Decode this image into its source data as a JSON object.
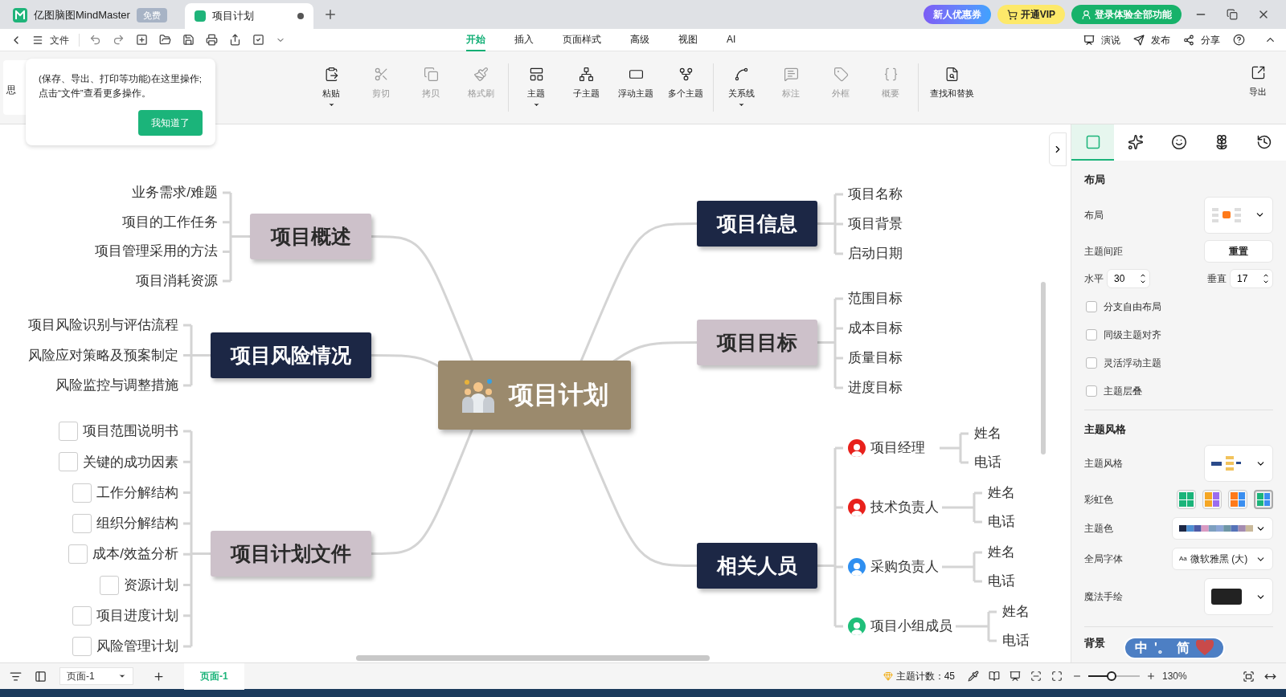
{
  "title_bar": {
    "app_tab": {
      "label": "亿图脑图MindMaster",
      "badge": "免费"
    },
    "doc_tab": {
      "label": "项目计划",
      "unsaved": true
    },
    "promos": [
      {
        "kind": "coupon",
        "label": "新人优惠券"
      },
      {
        "kind": "vip",
        "label": "开通VIP"
      },
      {
        "kind": "login",
        "label": "登录体验全部功能"
      }
    ]
  },
  "menu_bar": {
    "file": "文件",
    "tabs": [
      {
        "label": "开始",
        "selected": true
      },
      {
        "label": "插入",
        "selected": false
      },
      {
        "label": "页面样式",
        "selected": false
      },
      {
        "label": "高级",
        "selected": false
      },
      {
        "label": "视图",
        "selected": false
      },
      {
        "label": "AI",
        "selected": false
      }
    ],
    "actions": [
      {
        "kind": "present",
        "label": "演说"
      },
      {
        "kind": "publish",
        "label": "发布"
      },
      {
        "kind": "share",
        "label": "分享"
      }
    ]
  },
  "ribbon": {
    "hidden_item": "思",
    "groups": [
      [
        {
          "kind": "paste",
          "label": "粘贴",
          "disabled": false,
          "dropdown": true
        },
        {
          "kind": "cut",
          "label": "剪切",
          "disabled": true,
          "dropdown": false
        },
        {
          "kind": "copy",
          "label": "拷贝",
          "disabled": true,
          "dropdown": false
        },
        {
          "kind": "brush",
          "label": "格式刷",
          "disabled": true,
          "dropdown": false
        }
      ],
      [
        {
          "kind": "topic",
          "label": "主题",
          "disabled": false,
          "dropdown": true
        },
        {
          "kind": "subtopic",
          "label": "子主题",
          "disabled": false,
          "dropdown": false
        },
        {
          "kind": "float",
          "label": "浮动主题",
          "disabled": false,
          "dropdown": false
        },
        {
          "kind": "multi",
          "label": "多个主题",
          "disabled": false,
          "dropdown": false
        }
      ],
      [
        {
          "kind": "relation",
          "label": "关系线",
          "disabled": false,
          "dropdown": true
        },
        {
          "kind": "callout",
          "label": "标注",
          "disabled": true,
          "dropdown": false
        },
        {
          "kind": "boundary",
          "label": "外框",
          "disabled": true,
          "dropdown": false
        },
        {
          "kind": "summary",
          "label": "概要",
          "disabled": true,
          "dropdown": false
        }
      ],
      [
        {
          "kind": "find",
          "label": "查找和替换",
          "disabled": false,
          "dropdown": false
        }
      ]
    ],
    "export": "导出"
  },
  "tooltip": {
    "text": "(保存、导出、打印等功能)在这里操作;\n点击“文件”查看更多操作。",
    "button": "我知道了"
  },
  "mindmap": {
    "central": "项目计划",
    "branches": [
      {
        "label": "项目概述",
        "children": [
          {
            "kind": "text",
            "label": "业务需求/难题"
          },
          {
            "kind": "text",
            "label": "项目的工作任务"
          },
          {
            "kind": "text",
            "label": "项目管理采用的方法"
          },
          {
            "kind": "text",
            "label": "项目消耗资源"
          }
        ]
      },
      {
        "label": "项目风险情况",
        "children": [
          {
            "kind": "text",
            "label": "项目风险识别与评估流程"
          },
          {
            "kind": "text",
            "label": "风险应对策略及预案制定"
          },
          {
            "kind": "text",
            "label": "风险监控与调整措施"
          }
        ]
      },
      {
        "label": "项目计划文件",
        "children": [
          {
            "kind": "checkbox",
            "label": "项目范围说明书",
            "checked": false
          },
          {
            "kind": "checkbox",
            "label": "关键的成功因素",
            "checked": false
          },
          {
            "kind": "checkbox",
            "label": "工作分解结构",
            "checked": false
          },
          {
            "kind": "checkbox",
            "label": "组织分解结构",
            "checked": false
          },
          {
            "kind": "checkbox",
            "label": "成本/效益分析",
            "checked": false
          },
          {
            "kind": "checkbox",
            "label": "资源计划",
            "checked": false
          },
          {
            "kind": "checkbox",
            "label": "项目进度计划",
            "checked": false
          },
          {
            "kind": "checkbox",
            "label": "风险管理计划",
            "checked": false
          }
        ]
      },
      {
        "label": "项目信息",
        "children": [
          {
            "kind": "text",
            "label": "项目名称"
          },
          {
            "kind": "text",
            "label": "项目背景"
          },
          {
            "kind": "text",
            "label": "启动日期"
          }
        ]
      },
      {
        "label": "项目目标",
        "children": [
          {
            "kind": "text",
            "label": "范围目标"
          },
          {
            "kind": "text",
            "label": "成本目标"
          },
          {
            "kind": "text",
            "label": "质量目标"
          },
          {
            "kind": "text",
            "label": "进度目标"
          }
        ]
      },
      {
        "label": "相关人员",
        "children": [
          {
            "kind": "person",
            "label": "项目经理",
            "color": "#e8211c",
            "children": [
              "姓名",
              "电话"
            ]
          },
          {
            "kind": "person",
            "label": "技术负责人",
            "color": "#e8211c",
            "children": [
              "姓名",
              "电话"
            ]
          },
          {
            "kind": "person",
            "label": "采购负责人",
            "color": "#2f8ff0",
            "children": [
              "姓名",
              "电话"
            ]
          },
          {
            "kind": "person",
            "label": "项目小组成员",
            "color": "#1fbf7a",
            "children": [
              "姓名",
              "电话"
            ]
          }
        ]
      }
    ]
  },
  "panel": {
    "tabs": [
      {
        "kind": "layout",
        "selected": true
      },
      {
        "kind": "sparkle",
        "selected": false
      },
      {
        "kind": "emoji",
        "selected": false
      },
      {
        "kind": "badge",
        "selected": false
      },
      {
        "kind": "history",
        "selected": false
      }
    ],
    "layout_section": "布局",
    "layout_label": "布局",
    "spacing_label": "主题间距",
    "reset": "重置",
    "horizontal_label": "水平",
    "horizontal": "30",
    "vertical_label": "垂直",
    "vertical": "17",
    "options": [
      {
        "label": "分支自由布局",
        "checked": false
      },
      {
        "label": "同级主题对齐",
        "checked": false
      },
      {
        "label": "灵活浮动主题",
        "checked": false
      },
      {
        "label": "主题层叠",
        "checked": false
      }
    ],
    "style_section": "主题风格",
    "style_label": "主题风格",
    "rainbow_label": "彩虹色",
    "rainbow": [
      {
        "selected": false
      },
      {
        "selected": false
      },
      {
        "selected": false
      },
      {
        "selected": true
      }
    ],
    "theme_color_label": "主题色",
    "font_label": "全局字体",
    "font_sample": "Aa",
    "font": "微软雅黑 (大)",
    "hand_drawn_label": "魔法手绘",
    "background_section": "背景"
  },
  "status_bar": {
    "page_select": "页面-1",
    "pages": [
      {
        "label": "页面-1",
        "selected": true
      }
    ],
    "topic_count": "主题计数：45",
    "zoom": "130%"
  },
  "ime": {
    "mode": "中",
    "punct": "'。",
    "script": "简"
  }
}
